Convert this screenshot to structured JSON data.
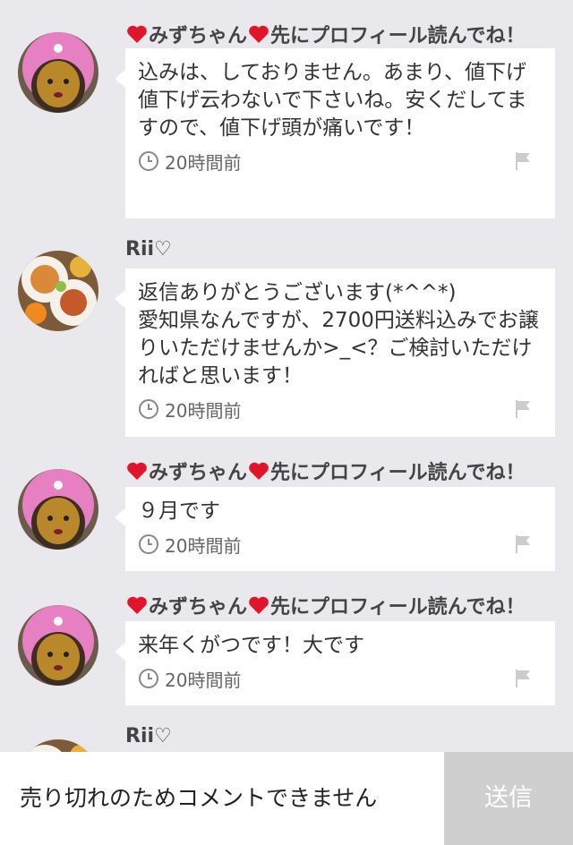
{
  "comments": [
    {
      "user": "みずちゃん",
      "user_suffix": "先にプロフィール読んでね！",
      "avatar": "pink-hat-avatar",
      "text": "込みは、しておりません。あまり、値下げ値下げ云わないで下さいね。安くだしてますので、値下げ頭が痛いです！",
      "time": "20時間前"
    },
    {
      "user": "Rii♡",
      "avatar": "food-photo-avatar",
      "text": "返信ありがとうございます(*^^*)\n愛知県なんですが、2700円送料込みでお譲りいただけませんか>_<？ご検討いただければと思います！",
      "time": "20時間前"
    },
    {
      "user": "みずちゃん",
      "user_suffix": "先にプロフィール読んでね！",
      "avatar": "pink-hat-avatar",
      "text": "９月です",
      "time": "20時間前"
    },
    {
      "user": "みずちゃん",
      "user_suffix": "先にプロフィール読んでね！",
      "avatar": "pink-hat-avatar",
      "text": "来年くがつです！大です",
      "time": "20時間前"
    },
    {
      "user": "Rii♡",
      "avatar": "food-photo-avatar"
    }
  ],
  "footer": {
    "sold_out_message": "売り切れのためコメントできません",
    "send_label": "送信"
  },
  "colors": {
    "background": "#e9e8ed",
    "bubble": "#ffffff",
    "heart": "#e0142a",
    "send_button": "#cfcfcf"
  },
  "icons": [
    "heart-icon",
    "clock-icon",
    "flag-icon"
  ]
}
